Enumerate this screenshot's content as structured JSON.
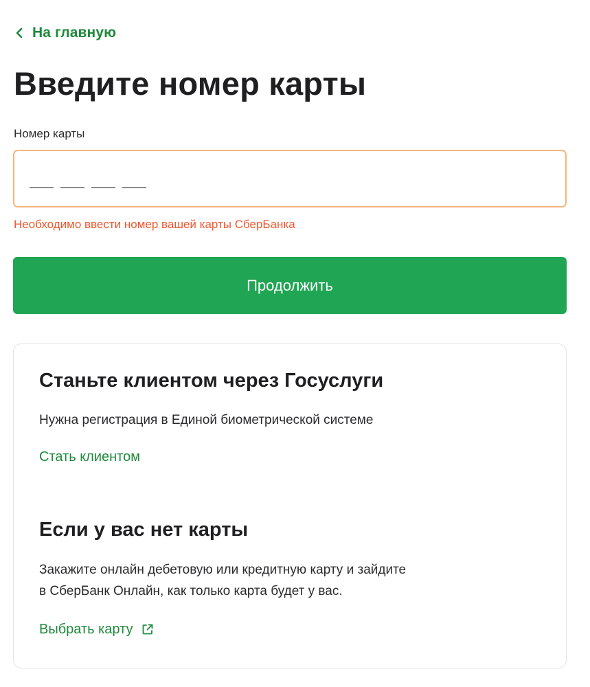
{
  "nav": {
    "back_label": "На главную",
    "back_icon": "chevron-left-icon"
  },
  "page": {
    "title": "Введите номер карты"
  },
  "card_field": {
    "label": "Номер карты",
    "value": "",
    "placeholder": "",
    "mask_groups": 4,
    "error": "Необходимо ввести номер вашей карты СберБанка"
  },
  "continue_button": {
    "label": "Продолжить"
  },
  "gosuslugi": {
    "title": "Станьте клиентом через Госуслуги",
    "text": "Нужна регистрация в Единой биометрической системе",
    "link": "Стать клиентом"
  },
  "no_card": {
    "title": "Если у вас нет карты",
    "text_line1": "Закажите онлайн дебетовую или кредитную карту и зайдите",
    "text_line2": "в СберБанк Онлайн, как только карта будет у вас.",
    "link": "Выбрать карту",
    "link_icon": "external-link-icon"
  },
  "colors": {
    "accent_green": "#1fa553",
    "link_green": "#1f8a3c",
    "error": "#f1572f",
    "input_error_border": "#f3b57d"
  }
}
